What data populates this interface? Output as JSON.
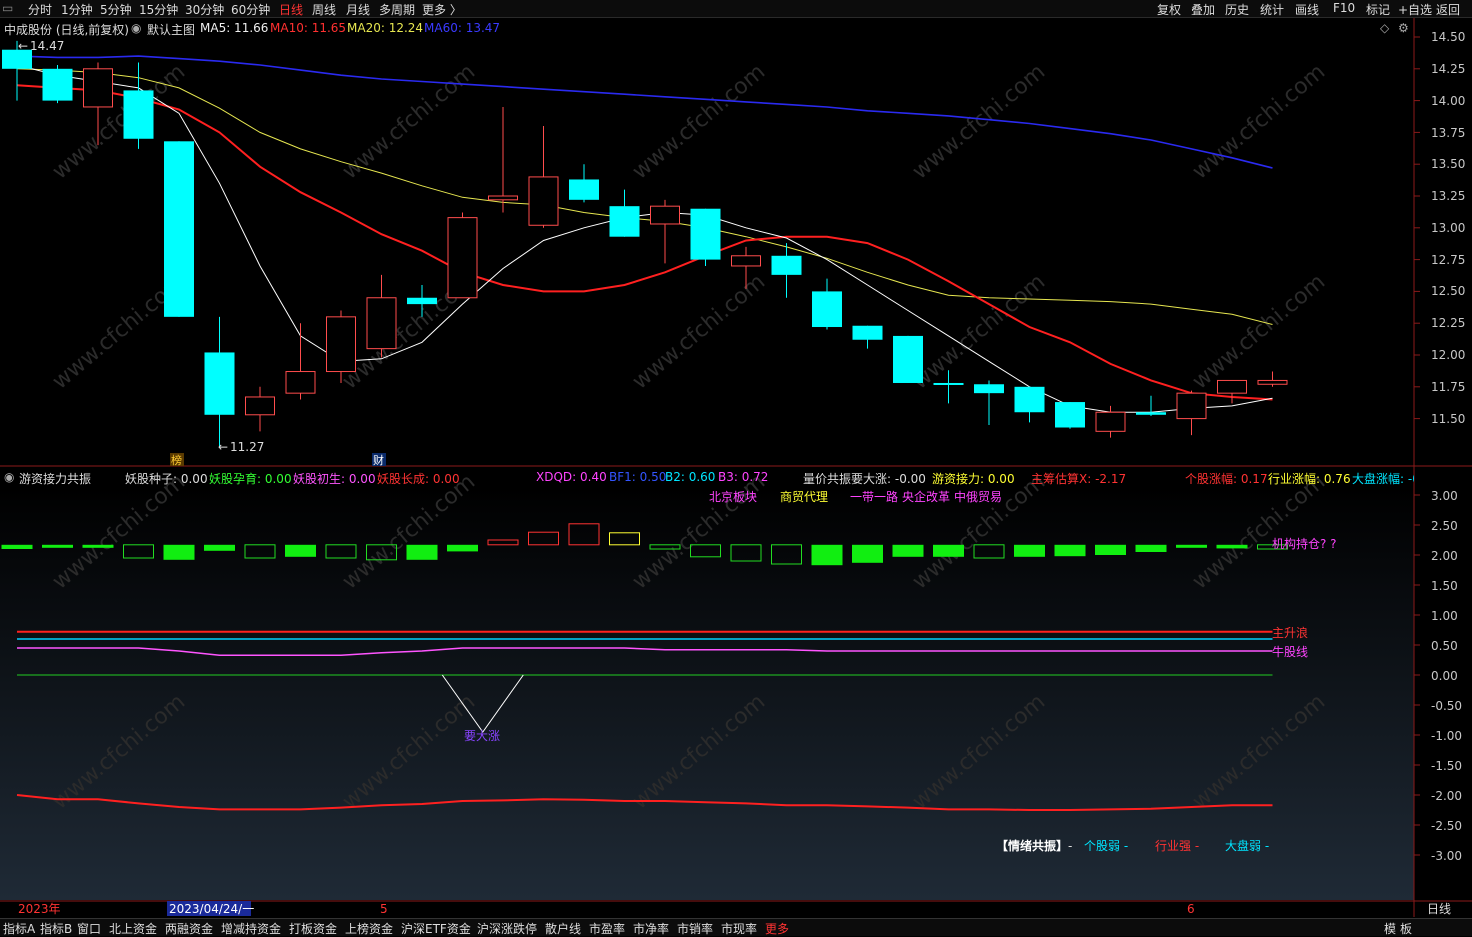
{
  "top_tabs": [
    {
      "label": "分时",
      "color": "#dddddd"
    },
    {
      "label": "1分钟",
      "color": "#dddddd"
    },
    {
      "label": "5分钟",
      "color": "#dddddd"
    },
    {
      "label": "15分钟",
      "color": "#dddddd"
    },
    {
      "label": "30分钟",
      "color": "#dddddd"
    },
    {
      "label": "60分钟",
      "color": "#dddddd"
    },
    {
      "label": "日线",
      "color": "#ff3333"
    },
    {
      "label": "周线",
      "color": "#dddddd"
    },
    {
      "label": "月线",
      "color": "#dddddd"
    },
    {
      "label": "多周期",
      "color": "#dddddd"
    },
    {
      "label": "更多 〉",
      "color": "#dddddd"
    }
  ],
  "top_right": [
    "复权",
    "叠加",
    "历史",
    "统计",
    "画线",
    "F10",
    "标记",
    "+自选",
    "返回"
  ],
  "main_header": {
    "stock": "中成股份 (日线,前复权)",
    "chart_name": "默认主图",
    "ma5": "MA5: 11.66",
    "ma10": "MA10: 11.65",
    "ma20": "MA20: 12.24",
    "ma60": "MA60: 13.47"
  },
  "price_axis": [
    "14.50",
    "14.25",
    "14.00",
    "13.75",
    "13.50",
    "13.25",
    "13.00",
    "12.75",
    "12.50",
    "12.25",
    "12.00",
    "11.75",
    "11.50"
  ],
  "price_annotations": {
    "high": "14.47",
    "low": "11.27",
    "mark1": "榜",
    "mark2": "财"
  },
  "sub_header": [
    {
      "text": "游资接力共振",
      "color": "#dddddd"
    },
    {
      "text": "妖股种子: 0.00",
      "color": "#dddddd"
    },
    {
      "text": "妖股孕育: 0.00",
      "color": "#33ff33"
    },
    {
      "text": "妖股初生: 0.00",
      "color": "#ff55ff"
    },
    {
      "text": "妖股长成: 0.00",
      "color": "#ff3333"
    },
    {
      "text": "XDQD: 0.40",
      "color": "#ff44ff"
    },
    {
      "text": "BF1: 0.50",
      "color": "#3355ff"
    },
    {
      "text": "B2: 0.60",
      "color": "#00e5ff"
    },
    {
      "text": "B3: 0.72",
      "color": "#ff44ff"
    },
    {
      "text": "量价共振要大涨: -0.00",
      "color": "#dddddd"
    },
    {
      "text": "游资接力: 0.00",
      "color": "#ffff33"
    },
    {
      "text": "主筹估算X: -2.17",
      "color": "#ff3333"
    },
    {
      "text": "个股涨幅: 0.17",
      "color": "#ff3333"
    },
    {
      "text": "行业涨幅: 0.76",
      "color": "#ffff33"
    },
    {
      "text": "大盘涨幅: -0",
      "color": "#00e5ff"
    }
  ],
  "sub_tags": {
    "tag1": "北京板块",
    "tag2": "商贸代理",
    "tag3": "一带一路",
    "tag4": "央企改革",
    "tag5": "中俄贸易",
    "holding": "机构持仓? ?",
    "wave": "主升浪",
    "bull": "牛股线",
    "rise": "要大涨",
    "emotion": "【情绪共振】",
    "emotion_dash": "-",
    "stock_weak": "个股弱 -",
    "industry_strong": "行业强 -",
    "market_weak": "大盘弱 -"
  },
  "sub_axis": [
    "3.00",
    "2.50",
    "2.00",
    "1.50",
    "1.00",
    "0.50",
    "0.00",
    "-0.50",
    "-1.00",
    "-1.50",
    "-2.00",
    "-2.50",
    "-3.00"
  ],
  "date_axis": {
    "year": "2023年",
    "cursor": "2023/04/24/一",
    "m5": "5",
    "m6": "6",
    "period": "日线"
  },
  "bottom_tabs": [
    "指标A",
    "指标B",
    "窗口",
    "北上资金",
    "两融资金",
    "增减持资金",
    "打板资金",
    "上榜资金",
    "沪深ETF资金",
    "沪深涨跌停",
    "散户线",
    "市盈率",
    "市净率",
    "市销率",
    "市现率",
    "更多"
  ],
  "bottom_right": [
    "模",
    "板"
  ],
  "watermark": "www.cfchi.com",
  "colors": {
    "up": "#ff4d4d",
    "down": "#00ffff",
    "ma5": "#ffffff",
    "ma10": "#ff2020",
    "ma20": "#e6e650",
    "ma60": "#2a2af0"
  },
  "chart_data": {
    "type": "candlestick",
    "candles": [
      {
        "o": 14.4,
        "h": 14.47,
        "l": 14.0,
        "c": 14.25
      },
      {
        "o": 14.25,
        "h": 14.28,
        "l": 13.98,
        "c": 14.0
      },
      {
        "o": 13.95,
        "h": 14.3,
        "l": 13.65,
        "c": 14.25
      },
      {
        "o": 14.08,
        "h": 14.3,
        "l": 13.62,
        "c": 13.7
      },
      {
        "o": 13.68,
        "h": 13.68,
        "l": 12.3,
        "c": 12.3
      },
      {
        "o": 12.02,
        "h": 12.3,
        "l": 11.27,
        "c": 11.53
      },
      {
        "o": 11.53,
        "h": 11.75,
        "l": 11.4,
        "c": 11.67
      },
      {
        "o": 11.7,
        "h": 12.25,
        "l": 11.65,
        "c": 11.87
      },
      {
        "o": 11.87,
        "h": 12.35,
        "l": 11.78,
        "c": 12.3
      },
      {
        "o": 12.05,
        "h": 12.63,
        "l": 11.98,
        "c": 12.45
      },
      {
        "o": 12.45,
        "h": 12.55,
        "l": 12.3,
        "c": 12.4
      },
      {
        "o": 12.45,
        "h": 13.12,
        "l": 12.45,
        "c": 13.08
      },
      {
        "o": 13.22,
        "h": 13.95,
        "l": 13.12,
        "c": 13.25
      },
      {
        "o": 13.02,
        "h": 13.8,
        "l": 13.0,
        "c": 13.4
      },
      {
        "o": 13.38,
        "h": 13.5,
        "l": 13.2,
        "c": 13.22
      },
      {
        "o": 13.17,
        "h": 13.3,
        "l": 12.93,
        "c": 12.93
      },
      {
        "o": 13.03,
        "h": 13.22,
        "l": 12.72,
        "c": 13.17
      },
      {
        "o": 13.15,
        "h": 13.15,
        "l": 12.7,
        "c": 12.75
      },
      {
        "o": 12.7,
        "h": 12.85,
        "l": 12.52,
        "c": 12.78
      },
      {
        "o": 12.78,
        "h": 12.88,
        "l": 12.45,
        "c": 12.63
      },
      {
        "o": 12.5,
        "h": 12.6,
        "l": 12.2,
        "c": 12.22
      },
      {
        "o": 12.23,
        "h": 12.23,
        "l": 12.05,
        "c": 12.12
      },
      {
        "o": 12.15,
        "h": 12.15,
        "l": 11.78,
        "c": 11.78
      },
      {
        "o": 11.78,
        "h": 11.88,
        "l": 11.62,
        "c": 11.77
      },
      {
        "o": 11.77,
        "h": 11.8,
        "l": 11.45,
        "c": 11.7
      },
      {
        "o": 11.75,
        "h": 11.75,
        "l": 11.47,
        "c": 11.55
      },
      {
        "o": 11.63,
        "h": 11.63,
        "l": 11.42,
        "c": 11.43
      },
      {
        "o": 11.4,
        "h": 11.6,
        "l": 11.35,
        "c": 11.55
      },
      {
        "o": 11.55,
        "h": 11.68,
        "l": 11.52,
        "c": 11.53
      },
      {
        "o": 11.5,
        "h": 11.72,
        "l": 11.37,
        "c": 11.7
      },
      {
        "o": 11.7,
        "h": 11.8,
        "l": 11.62,
        "c": 11.8
      },
      {
        "o": 11.77,
        "h": 11.87,
        "l": 11.75,
        "c": 11.8
      }
    ],
    "ma5": [
      14.28,
      14.2,
      14.15,
      14.1,
      13.9,
      13.35,
      12.7,
      12.15,
      11.95,
      11.97,
      12.1,
      12.4,
      12.68,
      12.9,
      13.0,
      13.08,
      13.12,
      13.1,
      13.0,
      12.92,
      12.75,
      12.55,
      12.35,
      12.15,
      11.95,
      11.75,
      11.6,
      11.55,
      11.55,
      11.58,
      11.6,
      11.66
    ],
    "ma10": [
      14.12,
      14.1,
      14.08,
      14.02,
      13.93,
      13.75,
      13.48,
      13.28,
      13.12,
      12.95,
      12.82,
      12.65,
      12.55,
      12.5,
      12.5,
      12.55,
      12.65,
      12.78,
      12.9,
      12.93,
      12.93,
      12.88,
      12.75,
      12.58,
      12.4,
      12.22,
      12.1,
      11.93,
      11.8,
      11.7,
      11.67,
      11.65
    ],
    "ma20": [
      14.25,
      14.24,
      14.22,
      14.18,
      14.1,
      13.94,
      13.75,
      13.62,
      13.52,
      13.43,
      13.33,
      13.24,
      13.2,
      13.18,
      13.12,
      13.08,
      13.05,
      13.0,
      12.93,
      12.85,
      12.76,
      12.65,
      12.55,
      12.47,
      12.45,
      12.44,
      12.43,
      12.42,
      12.4,
      12.36,
      12.32,
      12.24
    ],
    "ma60": [
      14.35,
      14.34,
      14.34,
      14.35,
      14.33,
      14.31,
      14.28,
      14.24,
      14.2,
      14.17,
      14.15,
      14.13,
      14.11,
      14.09,
      14.07,
      14.05,
      14.03,
      14.01,
      13.99,
      13.97,
      13.95,
      13.92,
      13.9,
      13.88,
      13.85,
      13.82,
      13.78,
      13.74,
      13.69,
      13.62,
      13.55,
      13.47
    ],
    "ylim": [
      11.27,
      14.47
    ],
    "sub_bars": [
      {
        "v": 2.1,
        "t": "g"
      },
      {
        "v": 2.12,
        "t": "g"
      },
      {
        "v": 2.12,
        "t": "g"
      },
      {
        "v": 1.95,
        "t": "go"
      },
      {
        "v": 1.92,
        "t": "g"
      },
      {
        "v": 2.07,
        "t": "g"
      },
      {
        "v": 1.95,
        "t": "go"
      },
      {
        "v": 1.97,
        "t": "g"
      },
      {
        "v": 1.95,
        "t": "go"
      },
      {
        "v": 1.92,
        "t": "go"
      },
      {
        "v": 1.92,
        "t": "g"
      },
      {
        "v": 2.06,
        "t": "g"
      },
      {
        "v": 2.25,
        "t": "ro"
      },
      {
        "v": 2.38,
        "t": "ro"
      },
      {
        "v": 2.52,
        "t": "ro"
      },
      {
        "v": 2.37,
        "t": "yo"
      },
      {
        "v": 2.1,
        "t": "go"
      },
      {
        "v": 1.97,
        "t": "go"
      },
      {
        "v": 1.9,
        "t": "go"
      },
      {
        "v": 1.85,
        "t": "go"
      },
      {
        "v": 1.83,
        "t": "g"
      },
      {
        "v": 1.87,
        "t": "g"
      },
      {
        "v": 1.97,
        "t": "g"
      },
      {
        "v": 1.97,
        "t": "g"
      },
      {
        "v": 1.95,
        "t": "go"
      },
      {
        "v": 1.97,
        "t": "g"
      },
      {
        "v": 1.98,
        "t": "g"
      },
      {
        "v": 2.0,
        "t": "g"
      },
      {
        "v": 2.05,
        "t": "g"
      },
      {
        "v": 2.12,
        "t": "g"
      },
      {
        "v": 2.11,
        "t": "g"
      },
      {
        "v": 2.1,
        "t": "go"
      }
    ],
    "sub_base": 2.17,
    "line_wave": 0.72,
    "line_b2": 0.6,
    "line_bull": [
      0.45,
      0.45,
      0.45,
      0.45,
      0.4,
      0.33,
      0.33,
      0.33,
      0.33,
      0.37,
      0.4,
      0.45,
      0.45,
      0.45,
      0.45,
      0.45,
      0.42,
      0.42,
      0.42,
      0.42,
      0.4,
      0.4,
      0.4,
      0.4,
      0.4,
      0.4,
      0.4,
      0.4,
      0.4,
      0.4,
      0.4,
      0.4
    ],
    "line_zero": 0.0,
    "v_points": [
      [
        10.5,
        0.0
      ],
      [
        11.5,
        -0.95
      ],
      [
        12.5,
        0.0
      ]
    ],
    "line_red": [
      -2.0,
      -2.07,
      -2.07,
      -2.14,
      -2.2,
      -2.24,
      -2.24,
      -2.24,
      -2.21,
      -2.17,
      -2.15,
      -2.1,
      -2.09,
      -2.07,
      -2.08,
      -2.1,
      -2.1,
      -2.12,
      -2.14,
      -2.17,
      -2.17,
      -2.19,
      -2.21,
      -2.24,
      -2.24,
      -2.25,
      -2.25,
      -2.24,
      -2.23,
      -2.2,
      -2.17,
      -2.17
    ],
    "sub_ylim": [
      -3.0,
      3.0
    ]
  }
}
